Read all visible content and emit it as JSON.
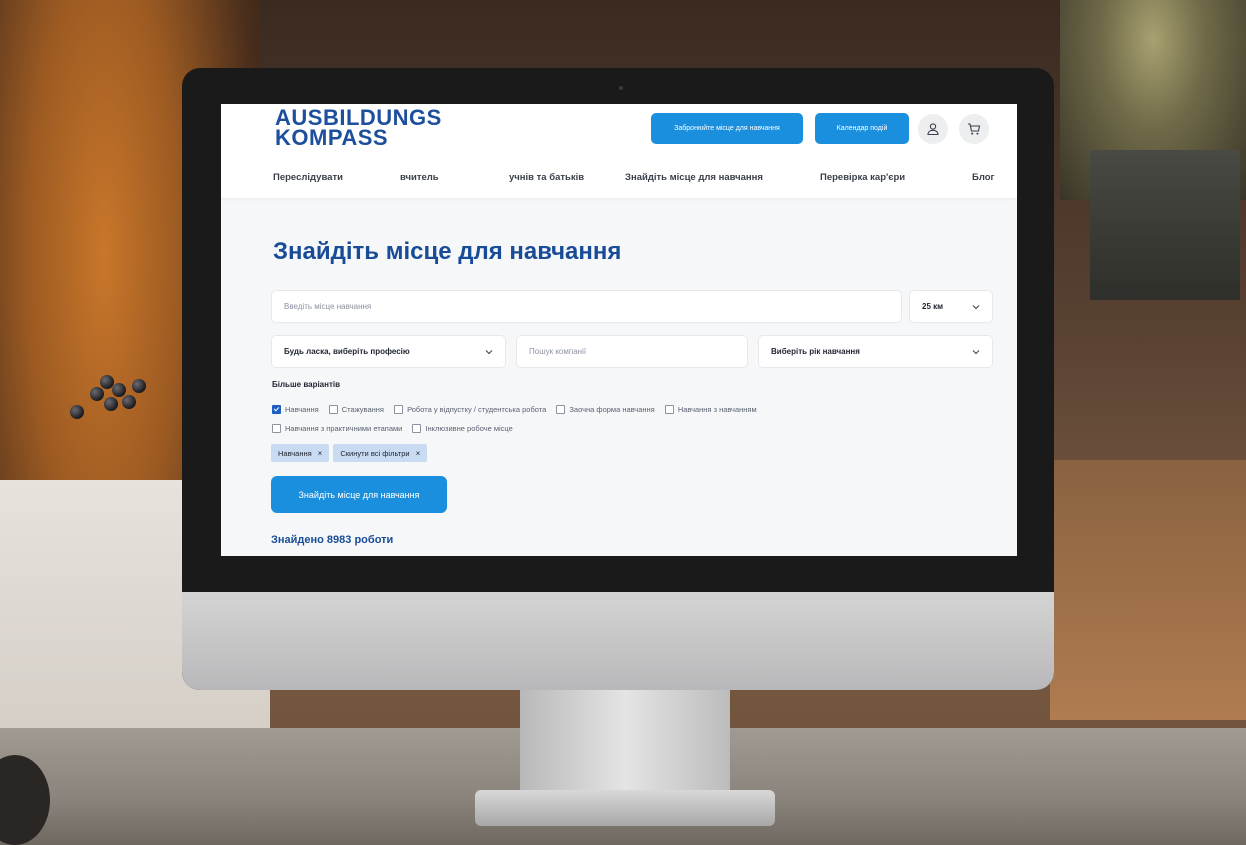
{
  "header": {
    "logo_line1": "AUSBILDUNGS",
    "logo_line2": "KOMPASS",
    "book_button": "Забронюйте місце для навчання",
    "calendar_button": "Календар подій",
    "user_icon": "user-icon",
    "cart_icon": "cart-icon"
  },
  "nav": {
    "items": [
      {
        "label": "Переслідувати"
      },
      {
        "label": "вчитель"
      },
      {
        "label": "учнів та батьків"
      },
      {
        "label": "Знайдіть місце для навчання"
      },
      {
        "label": "Перевірка кар'єри"
      },
      {
        "label": "Блог"
      }
    ]
  },
  "main": {
    "title": "Знайдіть місце для навчання",
    "location_placeholder": "Введіть місце навчання",
    "radius_value": "25 км",
    "profession_value": "Будь ласка, виберіть професію",
    "company_placeholder": "Пошук компанії",
    "year_value": "Виберіть рік навчання",
    "more_options": "Більше варіантів",
    "options": [
      {
        "label": "Навчання",
        "checked": true
      },
      {
        "label": "Стажування",
        "checked": false
      },
      {
        "label": "Робота у відпустку / студентська робота",
        "checked": false
      },
      {
        "label": "Заочна форма навчання",
        "checked": false
      },
      {
        "label": "Навчання з навчанням",
        "checked": false
      },
      {
        "label": "Навчання з практичними етапами",
        "checked": false
      },
      {
        "label": "Інклюзивне робоче місце",
        "checked": false
      }
    ],
    "chips": [
      {
        "label": "Навчання",
        "remove": "×"
      },
      {
        "label": "Скинути всі фільтри",
        "remove": "×"
      }
    ],
    "submit_button": "Знайдіть місце для навчання",
    "results_count": "Знайдено 8983 роботи"
  },
  "colors": {
    "brand_blue": "#184c96",
    "button_blue": "#1a8fde",
    "chip_bg": "#c9dbf3"
  }
}
